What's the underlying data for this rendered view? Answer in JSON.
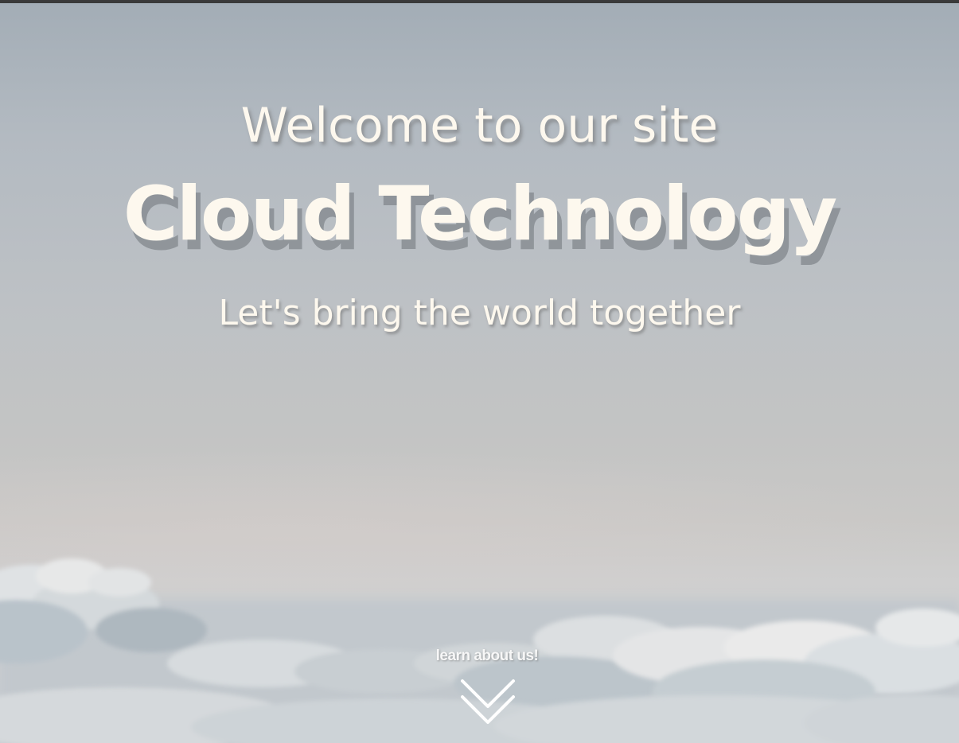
{
  "hero": {
    "welcome": "Welcome to our site",
    "title": "Cloud Technology",
    "tagline": "Let's bring the world together"
  },
  "cta": {
    "label": "learn about us!",
    "icon": "double-chevron-down-icon"
  },
  "colors": {
    "text": "#fdf8ee",
    "sky_top": "#a3adb6",
    "sky_bottom": "#c9c8c6"
  }
}
